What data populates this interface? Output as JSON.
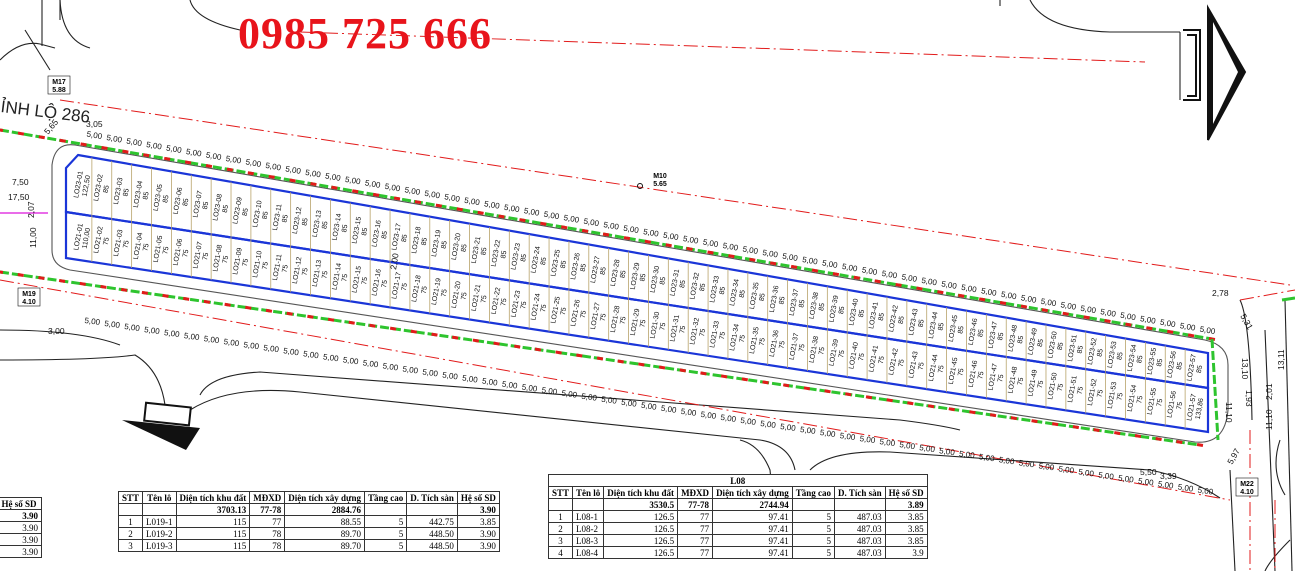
{
  "phone": "0985 725 666",
  "road_name": "ỈNH LỘ 286",
  "markers": [
    {
      "id": "M17",
      "value": "5.88"
    },
    {
      "id": "M19",
      "value": "4.10"
    },
    {
      "id": "M10",
      "value": "5.65"
    },
    {
      "id": "M22",
      "value": "4.10"
    }
  ],
  "dims": {
    "lot_width": "5,00",
    "top_start": "3,05",
    "top_end": "2,78",
    "bottom_start": "3,00",
    "bottom_end": "5,50",
    "bottom_end2": "3,39",
    "left": [
      "7,50",
      "17,50",
      "2,07",
      "11,00",
      "5,65"
    ],
    "right": [
      "5,31",
      "13,10",
      "11,10",
      "1,93",
      "5,97"
    ],
    "middle": "2,00",
    "far_right": [
      "11,10",
      "2,01",
      "13,11"
    ]
  },
  "row_top": {
    "prefix": "LO23-",
    "count": 57,
    "area": "85",
    "first_area": "122,50"
  },
  "row_bottom": {
    "prefix": "LO21-",
    "count": 57,
    "area": "75",
    "last_area": "133,86",
    "first_area": "110,00"
  },
  "table_left": {
    "headers": [
      "STT",
      "Tên lô",
      "Diện tích khu đất",
      "MĐXD",
      "Diện tích xây dựng",
      "Tầng cao",
      "D. Tích sàn",
      "Hệ số SD"
    ],
    "total": [
      "",
      "",
      "3703.13",
      "77-78",
      "2884.76",
      "",
      "",
      "3.90"
    ],
    "rows": [
      [
        "1",
        "L019-1",
        "115",
        "77",
        "88.55",
        "5",
        "442.75",
        "3.85"
      ],
      [
        "2",
        "L019-2",
        "115",
        "78",
        "89.70",
        "5",
        "448.50",
        "3.90"
      ],
      [
        "3",
        "L019-3",
        "115",
        "78",
        "89.70",
        "5",
        "448.50",
        "3.90"
      ]
    ]
  },
  "table_partial": {
    "header": "Hệ số SD",
    "values": [
      "3.90",
      "3.90",
      "3.90",
      "3.90"
    ]
  },
  "table_right": {
    "title": "L08",
    "headers": [
      "STT",
      "Tên lô",
      "Diện tích khu đất",
      "MĐXD",
      "Diện tích xây dựng",
      "Tầng cao",
      "D. Tích sàn",
      "Hệ số SD"
    ],
    "total": [
      "",
      "",
      "3530.5",
      "77-78",
      "2744.94",
      "",
      "",
      "3.89"
    ],
    "rows": [
      [
        "1",
        "L08-1",
        "126.5",
        "77",
        "97.41",
        "5",
        "487.03",
        "3.85"
      ],
      [
        "2",
        "L08-2",
        "126.5",
        "77",
        "97.41",
        "5",
        "487.03",
        "3.85"
      ],
      [
        "3",
        "L08-3",
        "126.5",
        "77",
        "97.41",
        "5",
        "487.03",
        "3.85"
      ],
      [
        "4",
        "L08-4",
        "126.5",
        "77",
        "97.41",
        "5",
        "487.03",
        "3.9"
      ]
    ]
  },
  "colors": {
    "block_outline": "#1a35d8",
    "dash_red": "#e21b1b",
    "hedge_green": "#2ec42e",
    "lot_line": "#b8a36a",
    "phone": "#e8141b"
  }
}
